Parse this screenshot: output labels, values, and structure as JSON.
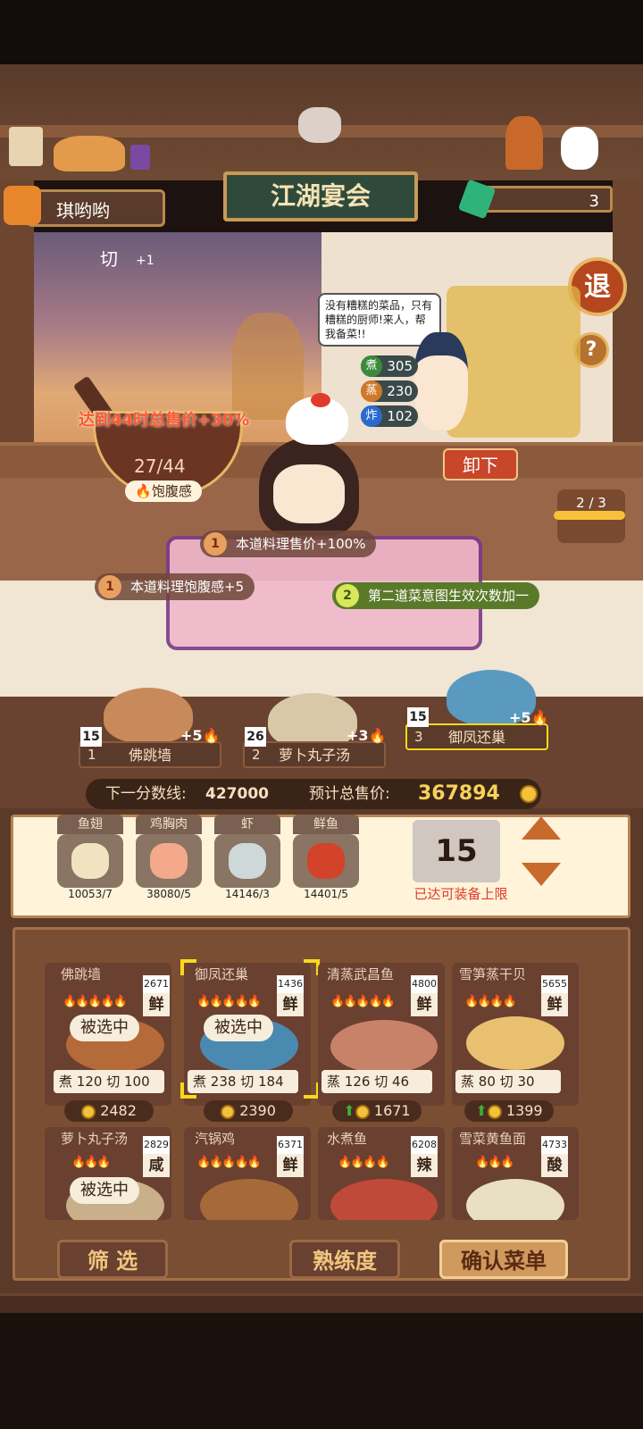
{
  "player": {
    "name": "琪哟哟"
  },
  "header": {
    "sign": "江湖宴会",
    "gems": "3"
  },
  "buttons": {
    "exit": "退",
    "help": "?",
    "unload": "卸下",
    "filter": "筛 选",
    "proficiency": "熟练度",
    "confirm": "确认菜单"
  },
  "scene": {
    "cut_label": "切",
    "cut_bonus": "+1",
    "speech": "没有糟糕的菜品，只有糟糕的厨师!来人，帮我备菜!!",
    "skills": [
      {
        "icon": "煮",
        "value": "305",
        "color": "#3a8a3a"
      },
      {
        "icon": "蒸",
        "value": "230",
        "color": "#d0782a"
      },
      {
        "icon": "炸",
        "value": "102",
        "color": "#2a6ad0"
      }
    ],
    "bonus_text": "达到44时总售价+30%",
    "satiety_value": "27/44",
    "satiety_label": "饱腹感",
    "round": "2 / 3"
  },
  "buffs": [
    {
      "num": "1",
      "text": "本道料理售价+100%"
    },
    {
      "num": "1",
      "text": "本道料理饱腹感+5"
    },
    {
      "num": "2",
      "text": "第二道菜意图生效次数加一"
    }
  ],
  "slots": [
    {
      "qty": "15",
      "plus": "+5",
      "index": "1",
      "name": "佛跳墙"
    },
    {
      "qty": "26",
      "plus": "+3",
      "index": "2",
      "name": "萝卜丸子汤"
    },
    {
      "qty": "15",
      "plus": "+5",
      "index": "3",
      "name": "御凤还巢"
    }
  ],
  "score": {
    "next_label": "下一分数线:",
    "next_value": "427000",
    "total_label": "预计总售价:",
    "total_value": "367894"
  },
  "ingredients": [
    {
      "name": "鱼翅",
      "count": "10053/7",
      "color": "#f1e3c0"
    },
    {
      "name": "鸡胸肉",
      "count": "38080/5",
      "color": "#f3a98a"
    },
    {
      "name": "虾",
      "count": "14146/3",
      "color": "#cfd8d8"
    },
    {
      "name": "鲜鱼",
      "count": "14401/5",
      "color": "#d2432a"
    }
  ],
  "equip": {
    "count": "15",
    "limit_text": "已达可装备上限"
  },
  "dishes": [
    {
      "name": "佛跳墙",
      "score": "2671",
      "flavor": "鲜",
      "flames": "🔥🔥🔥🔥🔥",
      "selected": "被选中",
      "m1": "煮",
      "v1": "120",
      "m2": "切",
      "v2": "100",
      "price": "2482",
      "color": "#b56a3a"
    },
    {
      "name": "御凤还巢",
      "score": "1436",
      "flavor": "鲜",
      "flames": "🔥🔥🔥🔥🔥",
      "selected": "被选中",
      "m1": "煮",
      "v1": "238",
      "m2": "切",
      "v2": "184",
      "price": "2390",
      "color": "#4a8ab0"
    },
    {
      "name": "清蒸武昌鱼",
      "score": "4800",
      "flavor": "鲜",
      "flames": "🔥🔥🔥🔥🔥",
      "selected": "",
      "m1": "蒸",
      "v1": "126",
      "m2": "切",
      "v2": "46",
      "price": "1671",
      "color": "#c9826a"
    },
    {
      "name": "雪笋蒸干贝",
      "score": "5655",
      "flavor": "鲜",
      "flames": "🔥🔥🔥🔥",
      "selected": "",
      "m1": "蒸",
      "v1": "80",
      "m2": "切",
      "v2": "30",
      "price": "1399",
      "color": "#e8c070"
    },
    {
      "name": "萝卜丸子汤",
      "score": "2829",
      "flavor": "咸",
      "flames": "🔥🔥🔥",
      "selected": "被选中",
      "color": "#c9b08a"
    },
    {
      "name": "汽锅鸡",
      "score": "6371",
      "flavor": "鲜",
      "flames": "🔥🔥🔥🔥🔥",
      "selected": "",
      "color": "#a66a3a"
    },
    {
      "name": "水煮鱼",
      "score": "6208",
      "flavor": "辣",
      "flames": "🔥🔥🔥🔥",
      "selected": "",
      "color": "#c04a3a"
    },
    {
      "name": "雪菜黄鱼面",
      "score": "4733",
      "flavor": "酸",
      "flames": "🔥🔥🔥",
      "selected": "",
      "color": "#e8e0c0"
    }
  ]
}
